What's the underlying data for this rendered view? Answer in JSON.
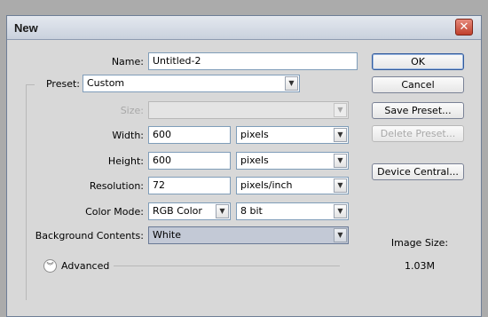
{
  "window": {
    "title": "New",
    "close_glyph": "✕"
  },
  "form": {
    "name": {
      "label": "Name:",
      "value": "Untitled-2"
    },
    "preset": {
      "label": "Preset:",
      "value": "Custom"
    },
    "size": {
      "label": "Size:",
      "value": ""
    },
    "width": {
      "label": "Width:",
      "value": "600",
      "unit": "pixels"
    },
    "height": {
      "label": "Height:",
      "value": "600",
      "unit": "pixels"
    },
    "resolution": {
      "label": "Resolution:",
      "value": "72",
      "unit": "pixels/inch"
    },
    "color_mode": {
      "label": "Color Mode:",
      "value": "RGB Color",
      "depth": "8 bit"
    },
    "background": {
      "label": "Background Contents:",
      "value": "White"
    },
    "advanced": {
      "label": "Advanced",
      "icon": "double-chevron-down-icon"
    }
  },
  "buttons": {
    "ok": "OK",
    "cancel": "Cancel",
    "save_preset": "Save Preset...",
    "delete_preset": "Delete Preset...",
    "device_central": "Device Central..."
  },
  "image_size": {
    "label": "Image Size:",
    "value": "1.03M"
  }
}
